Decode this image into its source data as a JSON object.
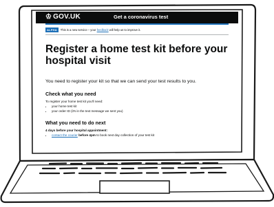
{
  "header": {
    "logo_text": "GOV.UK",
    "crown_glyph": "♔",
    "service_name": "Get a coronavirus test"
  },
  "banner": {
    "tag": "ALPHA",
    "text_before": "This is a new service – your ",
    "link": "feedback",
    "text_after": " will help us to improve it."
  },
  "page": {
    "title": "Register a home test kit before your hospital visit",
    "lede": "You need to register your kit so that we can send your test results to you."
  },
  "check_section": {
    "heading": "Check what you need",
    "intro": "To register your home test kit you'll need:",
    "items": [
      "your home test kit",
      "your order ID (it's in the text message we sent you)"
    ]
  },
  "next_section": {
    "heading": "What you need to do next",
    "subheading": "4 days before your hospital appointment:",
    "step_link": "contact the courier",
    "step_bold": " before 4pm",
    "step_rest": " to book next day collection of your test kit"
  },
  "colors": {
    "header_bg": "#0b0c0c",
    "brand_blue": "#1d70b8",
    "text": "#0b0c0c"
  }
}
